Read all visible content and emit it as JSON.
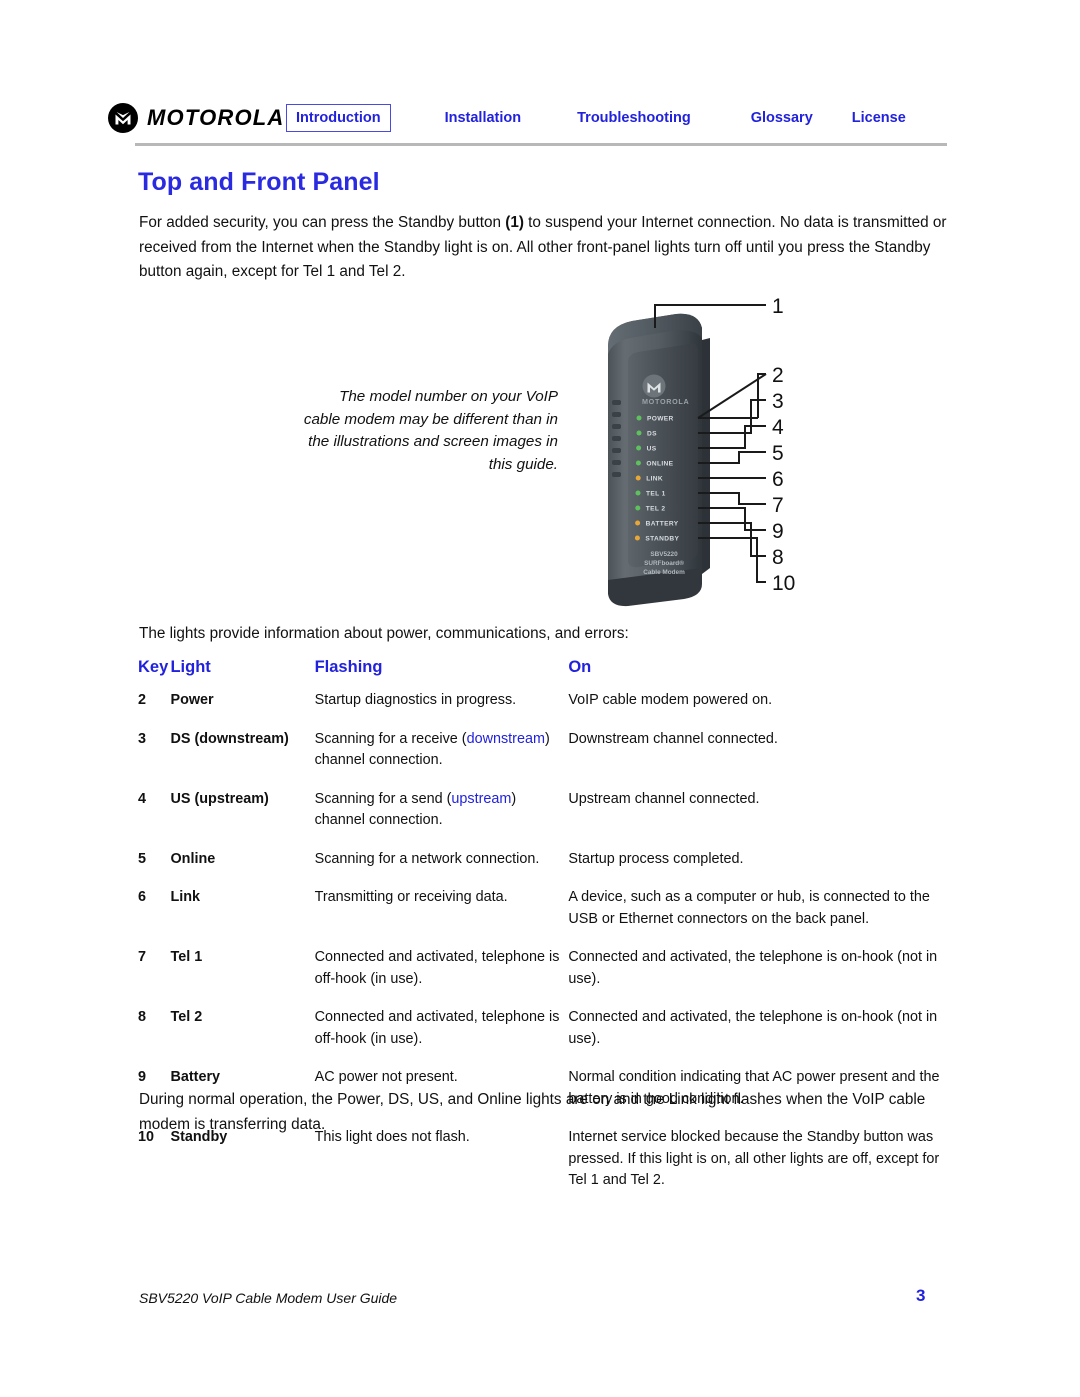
{
  "brand": {
    "logo_text": "MOTOROLA",
    "logo_icon": "motorola-batwing-icon"
  },
  "nav": {
    "items": [
      {
        "label": "Introduction",
        "active": true
      },
      {
        "label": "Installation",
        "active": false
      },
      {
        "label": "Troubleshooting",
        "active": false
      },
      {
        "label": "Glossary",
        "active": false
      },
      {
        "label": "License",
        "active": false
      }
    ]
  },
  "title": "Top and Front Panel",
  "intro": {
    "part1": "For added security, you can press the Standby button ",
    "bold_ref": "(1)",
    "part2": " to suspend your Internet connection. No data is transmitted or received from the Internet when the Standby light is on. All other front-panel lights turn off until you press the Standby button again, except for Tel 1 and Tel 2."
  },
  "note": "The model number on your VoIP cable modem may be different than in the illustrations and screen images in this guide.",
  "device": {
    "brand_label": "MOTOROLA",
    "model_line1": "SBV5220",
    "model_line2": "SURFboard®",
    "model_line3": "Cable Modem",
    "leds": [
      {
        "label": "POWER",
        "color": "#5ec15e"
      },
      {
        "label": "DS",
        "color": "#5ec15e"
      },
      {
        "label": "US",
        "color": "#5ec15e"
      },
      {
        "label": "ONLINE",
        "color": "#5ec15e"
      },
      {
        "label": "LINK",
        "color": "#e8a838"
      },
      {
        "label": "TEL 1",
        "color": "#5ec15e"
      },
      {
        "label": "TEL 2",
        "color": "#5ec15e"
      },
      {
        "label": "BATTERY",
        "color": "#e8a838"
      },
      {
        "label": "STANDBY",
        "color": "#e8a838"
      }
    ],
    "callouts": [
      "1",
      "2",
      "3",
      "4",
      "5",
      "6",
      "7",
      "8",
      "9",
      "10"
    ]
  },
  "lights_intro": "The lights provide information about power, communications, and errors:",
  "table": {
    "headers": [
      "Key",
      "Light",
      "Flashing",
      "On"
    ],
    "rows": [
      {
        "key": "2",
        "light": "Power",
        "flashing": "Startup diagnostics in progress.",
        "on": "VoIP cable modem powered on."
      },
      {
        "key": "3",
        "light": "DS (downstream)",
        "flashing_pre": "Scanning for a receive (",
        "flashing_link": "downstream",
        "flashing_post": ") channel connection.",
        "on": "Downstream channel connected."
      },
      {
        "key": "4",
        "light": "US (upstream)",
        "flashing_pre": "Scanning for a send (",
        "flashing_link": "upstream",
        "flashing_post": ") channel connection.",
        "on": "Upstream channel connected."
      },
      {
        "key": "5",
        "light": "Online",
        "flashing": "Scanning for a network connection.",
        "on": "Startup process completed."
      },
      {
        "key": "6",
        "light": "Link",
        "flashing": "Transmitting or receiving data.",
        "on": "A device, such as a computer or hub, is connected to the USB or Ethernet connectors on the back panel."
      },
      {
        "key": "7",
        "light": "Tel 1",
        "flashing": "Connected and activated, telephone is off-hook (in use).",
        "on": "Connected and activated, the telephone is on-hook (not in use)."
      },
      {
        "key": "8",
        "light": "Tel 2",
        "flashing": "Connected and activated, telephone is off-hook (in use).",
        "on": "Connected and activated, the telephone is on-hook (not in use)."
      },
      {
        "key": "9",
        "light": "Battery",
        "flashing": "AC power not present.",
        "on": "Normal condition indicating that AC power present and the battery is in good condition."
      },
      {
        "key": "10",
        "light": "Standby",
        "flashing": "This light does not flash.",
        "on": "Internet service blocked because the Standby button was pressed. If this light is on, all other lights are off, except for Tel 1 and Tel 2."
      }
    ]
  },
  "closing": "During normal operation, the Power, DS, US, and Online lights are on and the Link light flashes when the VoIP cable modem is transferring data.",
  "footer": {
    "guide": "SBV5220 VoIP Cable Modem User Guide",
    "page": "3"
  },
  "colors": {
    "link_blue": "#2222dd",
    "title_blue": "#2a2ae0",
    "rule_gray": "#b8b8b8"
  }
}
